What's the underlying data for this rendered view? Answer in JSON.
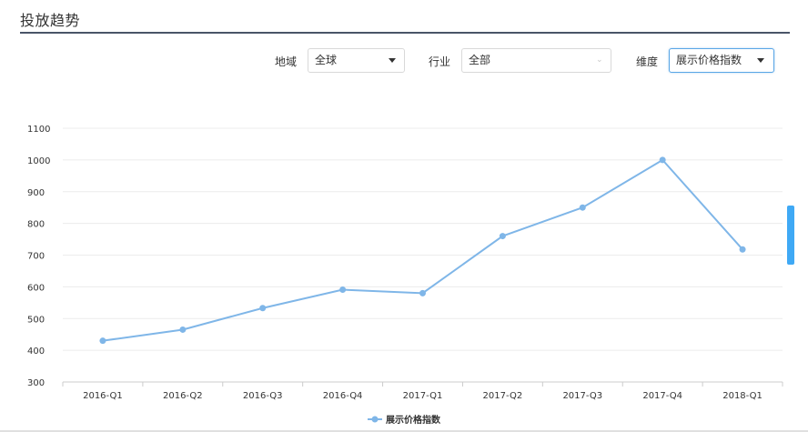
{
  "section": {
    "title": "投放趋势"
  },
  "filters": {
    "region": {
      "label": "地域",
      "value": "全球"
    },
    "industry": {
      "label": "行业",
      "value": "全部"
    },
    "dimension": {
      "label": "维度",
      "value": "展示价格指数"
    }
  },
  "colors": {
    "series": "#7fb6e8",
    "grid": "#ececec",
    "axis": "#cccccc",
    "active_border": "#5aa6e6",
    "scroll_handle": "#3fa9f5"
  },
  "chart_data": {
    "type": "line",
    "title": "",
    "xlabel": "",
    "ylabel": "",
    "categories": [
      "2016-Q1",
      "2016-Q2",
      "2016-Q3",
      "2016-Q4",
      "2017-Q1",
      "2017-Q2",
      "2017-Q3",
      "2017-Q4",
      "2018-Q1"
    ],
    "series": [
      {
        "name": "展示价格指数",
        "values": [
          430,
          465,
          533,
          591,
          580,
          760,
          850,
          1000,
          718
        ]
      }
    ],
    "ylim": [
      300,
      1100
    ],
    "yticks": [
      300,
      400,
      500,
      600,
      700,
      800,
      900,
      1000,
      1100
    ],
    "grid": true,
    "legend": "bottom-center"
  }
}
